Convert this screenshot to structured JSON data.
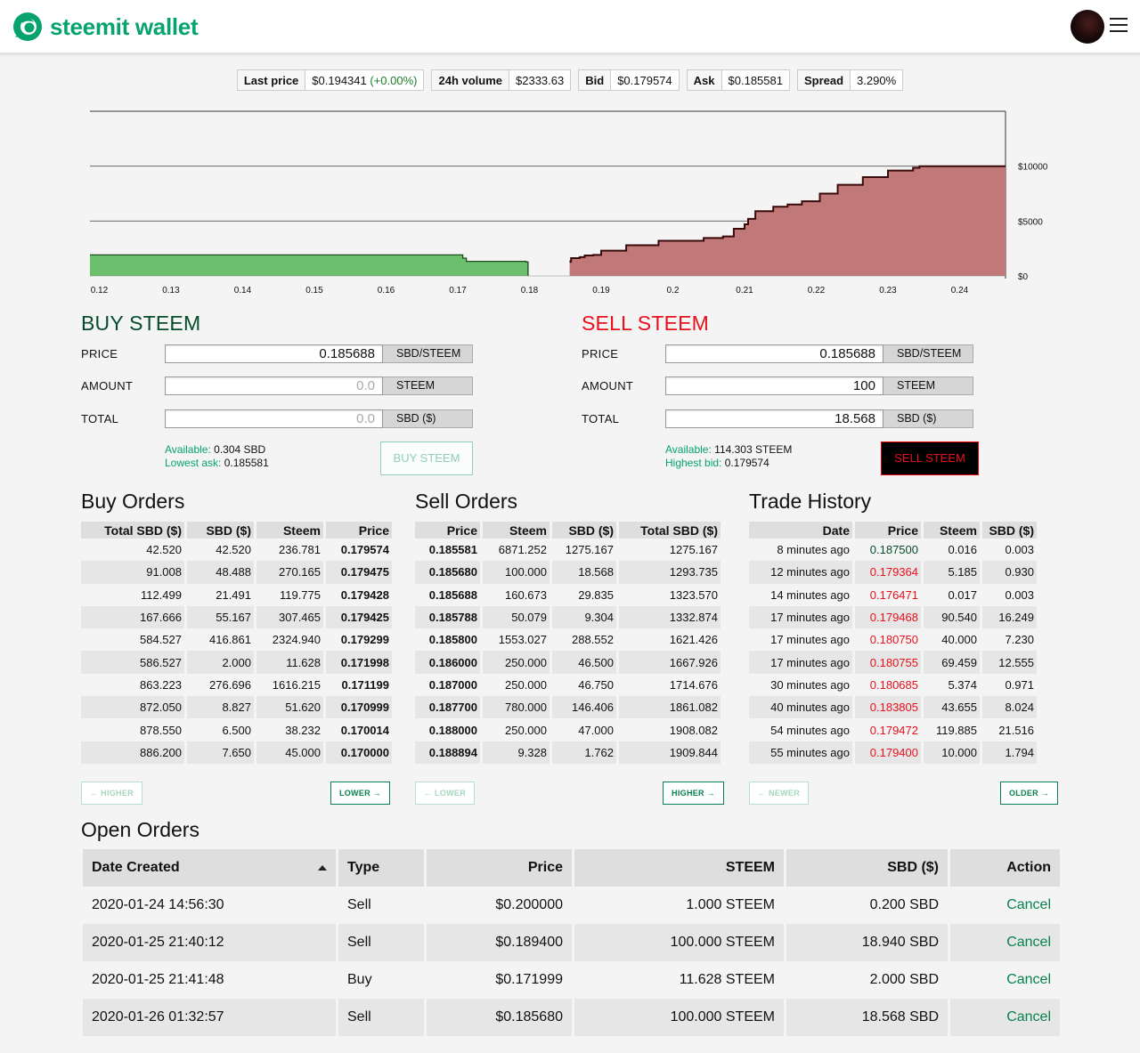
{
  "header": {
    "brand": "steemit wallet",
    "logo_icon": "steemit-logo-icon",
    "brand_color": "#06a36f"
  },
  "ticker": [
    {
      "label": "Last price",
      "value": "$0.194341",
      "change": "(+0.00%)"
    },
    {
      "label": "24h volume",
      "value": "$2333.63"
    },
    {
      "label": "Bid",
      "value": "$0.179574"
    },
    {
      "label": "Ask",
      "value": "$0.185581"
    },
    {
      "label": "Spread",
      "value": "3.290%"
    }
  ],
  "chart_data": {
    "type": "area",
    "x_ticks": [
      "0.12",
      "0.13",
      "0.14",
      "0.15",
      "0.16",
      "0.17",
      "0.18",
      "0.19",
      "0.2",
      "0.21",
      "0.22",
      "0.23",
      "0.24"
    ],
    "y_ticks": [
      "$0",
      "$5000",
      "$10000"
    ],
    "ylim": [
      0,
      15000
    ],
    "xlim": [
      0.1187,
      0.2464
    ],
    "series": [
      {
        "side": "bid",
        "color": "#6cbf6c",
        "points": [
          [
            0.1187,
            1909.8
          ],
          [
            0.17,
            1909.8
          ],
          [
            0.1707,
            1621.4
          ],
          [
            0.1712,
            1332.9
          ],
          [
            0.1795,
            1275.2
          ],
          [
            0.1798,
            0
          ]
        ]
      },
      {
        "side": "ask",
        "color": "#c07878",
        "points": [
          [
            0.1856,
            1275.2
          ],
          [
            0.1857,
            1323.6
          ],
          [
            0.1858,
            1621.4
          ],
          [
            0.187,
            1714.7
          ],
          [
            0.1877,
            1861.1
          ],
          [
            0.1889,
            1909.8
          ],
          [
            0.19,
            2300
          ],
          [
            0.1935,
            2800
          ],
          [
            0.198,
            3200
          ],
          [
            0.2043,
            3450
          ],
          [
            0.207,
            3600
          ],
          [
            0.2085,
            4300
          ],
          [
            0.21,
            4700
          ],
          [
            0.2105,
            5200
          ],
          [
            0.2115,
            5900
          ],
          [
            0.214,
            6300
          ],
          [
            0.216,
            6500
          ],
          [
            0.218,
            6800
          ],
          [
            0.2205,
            7500
          ],
          [
            0.223,
            8300
          ],
          [
            0.2265,
            9000
          ],
          [
            0.23,
            9600
          ],
          [
            0.2335,
            9850
          ],
          [
            0.2344,
            10000
          ],
          [
            0.2464,
            10000
          ]
        ]
      }
    ]
  },
  "buy_form": {
    "title": "BUY STEEM",
    "price_label": "PRICE",
    "price_value": "0.185688",
    "price_unit": "SBD/STEEM",
    "amount_label": "AMOUNT",
    "amount_placeholder": "0.0",
    "amount_unit": "STEEM",
    "total_label": "TOTAL",
    "total_placeholder": "0.0",
    "total_unit": "SBD ($)",
    "available_label": "Available:",
    "available_value": "0.304 SBD",
    "lowest_label": "Lowest ask:",
    "lowest_value": "0.185581",
    "button": "BUY STEEM"
  },
  "sell_form": {
    "title": "SELL STEEM",
    "price_label": "PRICE",
    "price_value": "0.185688",
    "price_unit": "SBD/STEEM",
    "amount_label": "AMOUNT",
    "amount_value": "100",
    "amount_unit": "STEEM",
    "total_label": "TOTAL",
    "total_value": "18.568",
    "total_unit": "SBD ($)",
    "available_label": "Available:",
    "available_value": "114.303 STEEM",
    "highest_label": "Highest bid:",
    "highest_value": "0.179574",
    "button": "SELL STEEM"
  },
  "buy_orders": {
    "title": "Buy Orders",
    "columns": [
      "Total SBD ($)",
      "SBD ($)",
      "Steem",
      "Price"
    ],
    "rows": [
      [
        "42.520",
        "42.520",
        "236.781",
        "0.179574"
      ],
      [
        "91.008",
        "48.488",
        "270.165",
        "0.179475"
      ],
      [
        "112.499",
        "21.491",
        "119.775",
        "0.179428"
      ],
      [
        "167.666",
        "55.167",
        "307.465",
        "0.179425"
      ],
      [
        "584.527",
        "416.861",
        "2324.940",
        "0.179299"
      ],
      [
        "586.527",
        "2.000",
        "11.628",
        "0.171998"
      ],
      [
        "863.223",
        "276.696",
        "1616.215",
        "0.171199"
      ],
      [
        "872.050",
        "8.827",
        "51.620",
        "0.170999"
      ],
      [
        "878.550",
        "6.500",
        "38.232",
        "0.170014"
      ],
      [
        "886.200",
        "7.650",
        "45.000",
        "0.170000"
      ]
    ],
    "prev": "← HIGHER",
    "next": "LOWER →"
  },
  "sell_orders": {
    "title": "Sell Orders",
    "columns": [
      "Price",
      "Steem",
      "SBD ($)",
      "Total SBD ($)"
    ],
    "rows": [
      [
        "0.185581",
        "6871.252",
        "1275.167",
        "1275.167"
      ],
      [
        "0.185680",
        "100.000",
        "18.568",
        "1293.735"
      ],
      [
        "0.185688",
        "160.673",
        "29.835",
        "1323.570"
      ],
      [
        "0.185788",
        "50.079",
        "9.304",
        "1332.874"
      ],
      [
        "0.185800",
        "1553.027",
        "288.552",
        "1621.426"
      ],
      [
        "0.186000",
        "250.000",
        "46.500",
        "1667.926"
      ],
      [
        "0.187000",
        "250.000",
        "46.750",
        "1714.676"
      ],
      [
        "0.187700",
        "780.000",
        "146.406",
        "1861.082"
      ],
      [
        "0.188000",
        "250.000",
        "47.000",
        "1908.082"
      ],
      [
        "0.188894",
        "9.328",
        "1.762",
        "1909.844"
      ]
    ],
    "prev": "← LOWER",
    "next": "HIGHER →"
  },
  "trade_history": {
    "title": "Trade History",
    "columns": [
      "Date",
      "Price",
      "Steem",
      "SBD ($)"
    ],
    "rows": [
      [
        "8 minutes ago",
        "0.187500",
        "0.016",
        "0.003",
        "up"
      ],
      [
        "12 minutes ago",
        "0.179364",
        "5.185",
        "0.930",
        "dn"
      ],
      [
        "14 minutes ago",
        "0.176471",
        "0.017",
        "0.003",
        "dn"
      ],
      [
        "17 minutes ago",
        "0.179468",
        "90.540",
        "16.249",
        "dn"
      ],
      [
        "17 minutes ago",
        "0.180750",
        "40.000",
        "7.230",
        "dn"
      ],
      [
        "17 minutes ago",
        "0.180755",
        "69.459",
        "12.555",
        "dn"
      ],
      [
        "30 minutes ago",
        "0.180685",
        "5.374",
        "0.971",
        "dn"
      ],
      [
        "40 minutes ago",
        "0.183805",
        "43.655",
        "8.024",
        "dn"
      ],
      [
        "54 minutes ago",
        "0.179472",
        "119.885",
        "21.516",
        "dn"
      ],
      [
        "55 minutes ago",
        "0.179400",
        "10.000",
        "1.794",
        "dn"
      ]
    ],
    "prev": "← NEWER",
    "next": "OLDER →"
  },
  "open_orders": {
    "title": "Open Orders",
    "columns": [
      "Date Created",
      "Type",
      "Price",
      "STEEM",
      "SBD ($)",
      "Action"
    ],
    "rows": [
      [
        "2020-01-24 14:56:30",
        "Sell",
        "$0.200000",
        "1.000 STEEM",
        "0.200 SBD",
        "Cancel"
      ],
      [
        "2020-01-25 21:40:12",
        "Sell",
        "$0.189400",
        "100.000 STEEM",
        "18.940 SBD",
        "Cancel"
      ],
      [
        "2020-01-25 21:41:48",
        "Buy",
        "$0.171999",
        "11.628 STEEM",
        "2.000 SBD",
        "Cancel"
      ],
      [
        "2020-01-26 01:32:57",
        "Sell",
        "$0.185680",
        "100.000 STEEM",
        "18.568 SBD",
        "Cancel"
      ]
    ]
  }
}
